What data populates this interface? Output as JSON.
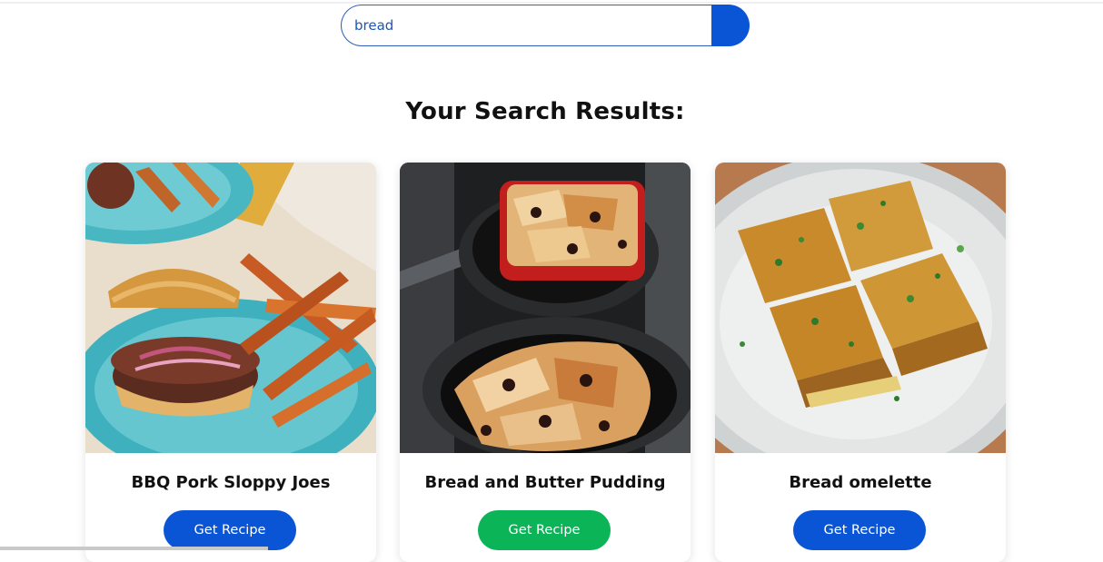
{
  "search": {
    "value": "bread",
    "button_icon": "search-icon",
    "button_color": "#0a55d6"
  },
  "results_heading": "Your Search Results:",
  "results": [
    {
      "title": "BBQ Pork Sloppy Joes",
      "button_label": "Get Recipe",
      "button_color": "#0a55d6",
      "image": "sloppy-joe-with-sweet-potato-fries"
    },
    {
      "title": "Bread and Butter Pudding",
      "button_label": "Get Recipe",
      "button_color": "#0ab457",
      "image": "bread-pudding-in-skillets"
    },
    {
      "title": "Bread omelette",
      "button_label": "Get Recipe",
      "button_color": "#0a55d6",
      "image": "bread-omelette-sandwich-on-plate"
    }
  ]
}
